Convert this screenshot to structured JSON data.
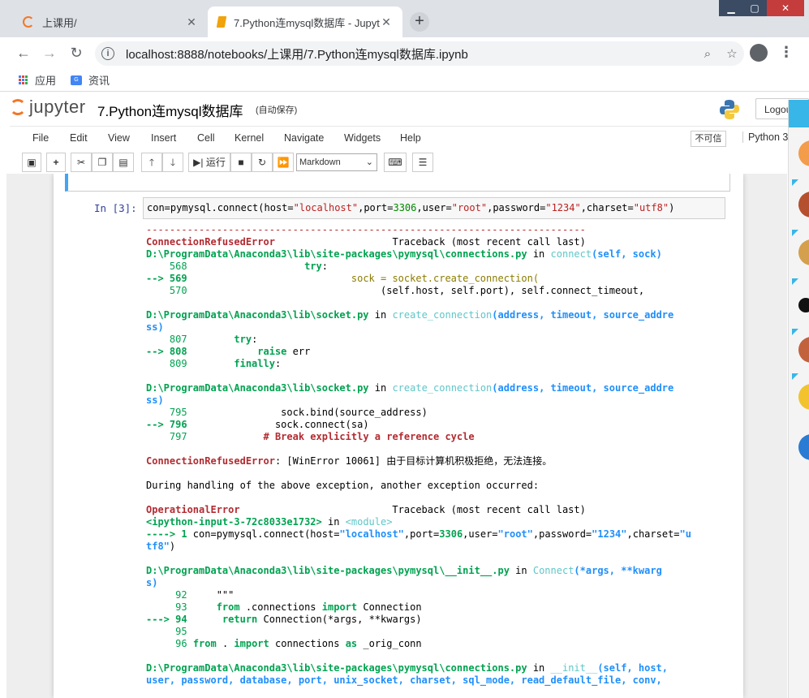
{
  "browser": {
    "tabs": [
      {
        "title": "上课用/",
        "active": false
      },
      {
        "title": "7.Python连mysql数据库 - Jupyt",
        "active": true
      }
    ],
    "url": "localhost:8888/notebooks/上课用/7.Python连mysql数据库.ipynb",
    "bookmarks": [
      "应用",
      "资讯"
    ]
  },
  "jupyter": {
    "logo_text": "jupyter",
    "notebook_title": "7.Python连mysql数据库",
    "autosave": "(自动保存)",
    "logout": "Logou",
    "menu": [
      "File",
      "Edit",
      "View",
      "Insert",
      "Cell",
      "Kernel",
      "Navigate",
      "Widgets",
      "Help"
    ],
    "trusted": "不可信",
    "kernel": "Python 3",
    "toolbar": {
      "run_label": "运行",
      "cell_type": "Markdown"
    }
  },
  "cell": {
    "prompt": "In  [3]:",
    "code_parts": [
      "con=pymysql.connect(host=",
      "\"localhost\"",
      ",port=",
      "3306",
      ",user=",
      "\"root\"",
      ",password=",
      "\"1234\"",
      ",charset=",
      "\"utf8\"",
      ")"
    ]
  },
  "traceback": [
    [
      [
        "sep",
        "---------------------------------------------------------------------------"
      ]
    ],
    [
      [
        "redb",
        "ConnectionRefusedError"
      ],
      [
        "",
        "                    Traceback (most recent call last)"
      ]
    ],
    [
      [
        "greenb",
        "D:\\ProgramData\\Anaconda3\\lib\\site-packages\\pymysql\\connections.py"
      ],
      [
        "",
        " in "
      ],
      [
        "cyan",
        "connect"
      ],
      [
        "blueb",
        "(self, sock)"
      ]
    ],
    [
      [
        "green",
        "    568"
      ],
      [
        "",
        "                    "
      ],
      [
        "greenb",
        "try"
      ],
      [
        "",
        ":"
      ]
    ],
    [
      [
        "greenb",
        "--> 569"
      ],
      [
        "olive",
        "                            sock = socket.create_connection("
      ]
    ],
    [
      [
        "green",
        "    570"
      ],
      [
        "",
        "                                 (self.host, self.port), self.connect_timeout,"
      ]
    ],
    [
      [
        "",
        ""
      ]
    ],
    [
      [
        "greenb",
        "D:\\ProgramData\\Anaconda3\\lib\\socket.py"
      ],
      [
        "",
        " in "
      ],
      [
        "cyan",
        "create_connection"
      ],
      [
        "blueb",
        "(address, timeout, source_addre"
      ]
    ],
    [
      [
        "blueb",
        "ss)"
      ]
    ],
    [
      [
        "green",
        "    807"
      ],
      [
        "",
        "        "
      ],
      [
        "greenb",
        "try"
      ],
      [
        "",
        ":"
      ]
    ],
    [
      [
        "greenb",
        "--> 808"
      ],
      [
        "",
        "            "
      ],
      [
        "greenb",
        "raise"
      ],
      [
        "",
        " err"
      ]
    ],
    [
      [
        "green",
        "    809"
      ],
      [
        "",
        "        "
      ],
      [
        "greenb",
        "finally"
      ],
      [
        "",
        ":"
      ]
    ],
    [
      [
        "",
        ""
      ]
    ],
    [
      [
        "greenb",
        "D:\\ProgramData\\Anaconda3\\lib\\socket.py"
      ],
      [
        "",
        " in "
      ],
      [
        "cyan",
        "create_connection"
      ],
      [
        "blueb",
        "(address, timeout, source_addre"
      ]
    ],
    [
      [
        "blueb",
        "ss)"
      ]
    ],
    [
      [
        "green",
        "    795"
      ],
      [
        "",
        "                sock.bind(source_address)"
      ]
    ],
    [
      [
        "greenb",
        "--> 796"
      ],
      [
        "",
        "               sock.connect(sa)"
      ]
    ],
    [
      [
        "green",
        "    797"
      ],
      [
        "redb",
        "             # Break explicitly a reference cycle"
      ]
    ],
    [
      [
        "",
        ""
      ]
    ],
    [
      [
        "redb",
        "ConnectionRefusedError"
      ],
      [
        "",
        ": [WinError 10061] 由于目标计算机积极拒绝，无法连接。"
      ]
    ],
    [
      [
        "",
        ""
      ]
    ],
    [
      [
        "",
        "During handling of the above exception, another exception occurred:"
      ]
    ],
    [
      [
        "",
        ""
      ]
    ],
    [
      [
        "redb",
        "OperationalError"
      ],
      [
        "",
        "                          Traceback (most recent call last)"
      ]
    ],
    [
      [
        "greenb",
        "<ipython-input-3-72c8033e1732>"
      ],
      [
        "",
        " in "
      ],
      [
        "cyan",
        "<module>"
      ]
    ],
    [
      [
        "greenb",
        "----> 1"
      ],
      [
        "",
        " con=pymysql.connect(host="
      ],
      [
        "blueb",
        "\"localhost\""
      ],
      [
        "",
        ",port="
      ],
      [
        "greenb",
        "3306"
      ],
      [
        "",
        ",user="
      ],
      [
        "blueb",
        "\"root\""
      ],
      [
        "",
        ",password="
      ],
      [
        "blueb",
        "\"1234\""
      ],
      [
        "",
        ",charset="
      ],
      [
        "blueb",
        "\"u"
      ]
    ],
    [
      [
        "blueb",
        "tf8\""
      ],
      [
        "",
        ")"
      ]
    ],
    [
      [
        "",
        ""
      ]
    ],
    [
      [
        "greenb",
        "D:\\ProgramData\\Anaconda3\\lib\\site-packages\\pymysql\\__init__.py"
      ],
      [
        "",
        " in "
      ],
      [
        "cyan",
        "Connect"
      ],
      [
        "blueb",
        "(*args, **kwarg"
      ]
    ],
    [
      [
        "blueb",
        "s)"
      ]
    ],
    [
      [
        "green",
        "     92"
      ],
      [
        "",
        "     \"\"\""
      ]
    ],
    [
      [
        "green",
        "     93"
      ],
      [
        "",
        "     "
      ],
      [
        "greenb",
        "from"
      ],
      [
        "",
        " .connections "
      ],
      [
        "greenb",
        "import"
      ],
      [
        "",
        " Connection"
      ]
    ],
    [
      [
        "greenb",
        "---> 94"
      ],
      [
        "",
        "      "
      ],
      [
        "greenb",
        "return"
      ],
      [
        "",
        " Connection(*args, **kwargs)"
      ]
    ],
    [
      [
        "green",
        "     95"
      ],
      [
        "",
        ""
      ]
    ],
    [
      [
        "green",
        "     96"
      ],
      [
        "",
        " "
      ],
      [
        "greenb",
        "from"
      ],
      [
        "",
        " . "
      ],
      [
        "greenb",
        "import"
      ],
      [
        "",
        " connections "
      ],
      [
        "greenb",
        "as"
      ],
      [
        "",
        " _orig_conn"
      ]
    ],
    [
      [
        "",
        ""
      ]
    ],
    [
      [
        "greenb",
        "D:\\ProgramData\\Anaconda3\\lib\\site-packages\\pymysql\\connections.py"
      ],
      [
        "",
        " in "
      ],
      [
        "cyan",
        "__init__"
      ],
      [
        "blueb",
        "(self, host,"
      ]
    ],
    [
      [
        "blueb",
        "user, password, database, port, unix_socket, charset, sql_mode, read_default_file, conv,"
      ]
    ]
  ]
}
